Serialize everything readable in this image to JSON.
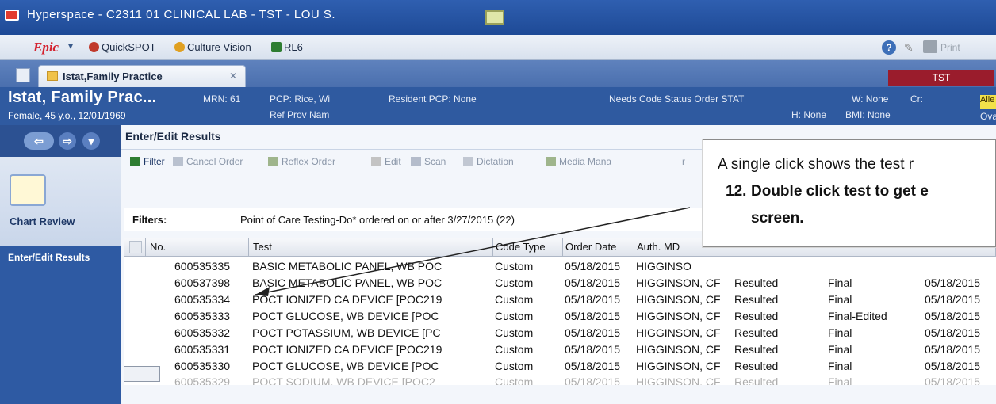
{
  "window": {
    "title": "Hyperspace - C2311 01 CLINICAL LAB - TST - LOU S."
  },
  "menubar": {
    "epic_label": "Epic",
    "items": [
      {
        "label": "QuickSPOT",
        "icon": "quickspot-icon",
        "color": "#c0392b"
      },
      {
        "label": "Culture Vision",
        "icon": "culture-vision-icon",
        "color": "#e0a021"
      },
      {
        "label": "RL6",
        "icon": "rl6-icon",
        "color": "#2e7d32"
      }
    ],
    "print_label": "Print"
  },
  "tabbar": {
    "tab_label": "Istat,Family Practice",
    "env_badge": "TST"
  },
  "patient": {
    "name": "Istat, Family Prac...",
    "demographics": "Female, 45 y.o., 12/01/1969",
    "mrn": "MRN: 61",
    "pcp": "PCP: Rice, Wi",
    "ref_prov": "Ref Prov Nam",
    "resident_pcp": "Resident PCP: None",
    "code_status": "Needs Code Status Order STAT",
    "w": "W: None",
    "cr": "Cr:",
    "h": "H: None",
    "bmi": "BMI: None",
    "alle": "Alle",
    "ova": "Ova"
  },
  "sidebar": {
    "chart_review": "Chart Review",
    "active": "Enter/Edit Results"
  },
  "main": {
    "activity_title": "Enter/Edit Results",
    "toolbar": [
      {
        "label": "Filter",
        "enabled": true,
        "icon": "filter-icon"
      },
      {
        "label": "Cancel Order",
        "enabled": false,
        "icon": "cancel-icon"
      },
      {
        "label": "Reflex Order",
        "enabled": false,
        "icon": "reflex-icon"
      },
      {
        "label": "Edit",
        "enabled": false,
        "icon": "edit-icon"
      },
      {
        "label": "Scan",
        "enabled": false,
        "icon": "scan-icon"
      },
      {
        "label": "Dictation",
        "enabled": false,
        "icon": "dictation-icon"
      },
      {
        "label": "Media Mana",
        "enabled": false,
        "icon": "media-icon"
      }
    ],
    "toolbar_tail": "r",
    "filters_label": "Filters:",
    "filters_value": "Point of Care Testing-Do* ordered on or after 3/27/2015 (22)"
  },
  "grid": {
    "columns": [
      "No.",
      "Test",
      "Code Type",
      "Order Date",
      "Auth. MD"
    ],
    "rows": [
      {
        "no": "600535335",
        "test": "BASIC METABOLIC PANEL, WB POC",
        "code": "Custom",
        "date": "05/18/2015",
        "md": "HIGGINSO",
        "status": "",
        "result": "",
        "date2": ""
      },
      {
        "no": "600537398",
        "test": "BASIC METABOLIC PANEL, WB POC",
        "code": "Custom",
        "date": "05/18/2015",
        "md": "HIGGINSON, CF",
        "status": "Resulted",
        "result": "Final",
        "date2": "05/18/2015"
      },
      {
        "no": "600535334",
        "test": "POCT IONIZED CA DEVICE [POC219",
        "code": "Custom",
        "date": "05/18/2015",
        "md": "HIGGINSON, CF",
        "status": "Resulted",
        "result": "Final",
        "date2": "05/18/2015"
      },
      {
        "no": "600535333",
        "test": "POCT GLUCOSE, WB DEVICE [POC",
        "code": "Custom",
        "date": "05/18/2015",
        "md": "HIGGINSON, CF",
        "status": "Resulted",
        "result": "Final-Edited",
        "date2": "05/18/2015"
      },
      {
        "no": "600535332",
        "test": "POCT POTASSIUM, WB DEVICE [PC",
        "code": "Custom",
        "date": "05/18/2015",
        "md": "HIGGINSON, CF",
        "status": "Resulted",
        "result": "Final",
        "date2": "05/18/2015"
      },
      {
        "no": "600535331",
        "test": "POCT IONIZED CA DEVICE [POC219",
        "code": "Custom",
        "date": "05/18/2015",
        "md": "HIGGINSON, CF",
        "status": "Resulted",
        "result": "Final",
        "date2": "05/18/2015"
      },
      {
        "no": "600535330",
        "test": "POCT GLUCOSE, WB DEVICE [POC",
        "code": "Custom",
        "date": "05/18/2015",
        "md": "HIGGINSON, CF",
        "status": "Resulted",
        "result": "Final",
        "date2": "05/18/2015"
      },
      {
        "no": "600535329",
        "test": "POCT SODIUM, WB DEVICE [POC2",
        "code": "Custom",
        "date": "05/18/2015",
        "md": "HIGGINSON, CF",
        "status": "Resulted",
        "result": "Final",
        "date2": "05/18/2015"
      }
    ]
  },
  "callout": {
    "line1": "A single click shows the test r",
    "line2_num": "12.",
    "line2": "Double click test to get e",
    "line3": "screen."
  },
  "colors": {
    "accent": "#2f5aa0",
    "env_badge": "#9a1c2c",
    "epic_red": "#d4212e"
  }
}
